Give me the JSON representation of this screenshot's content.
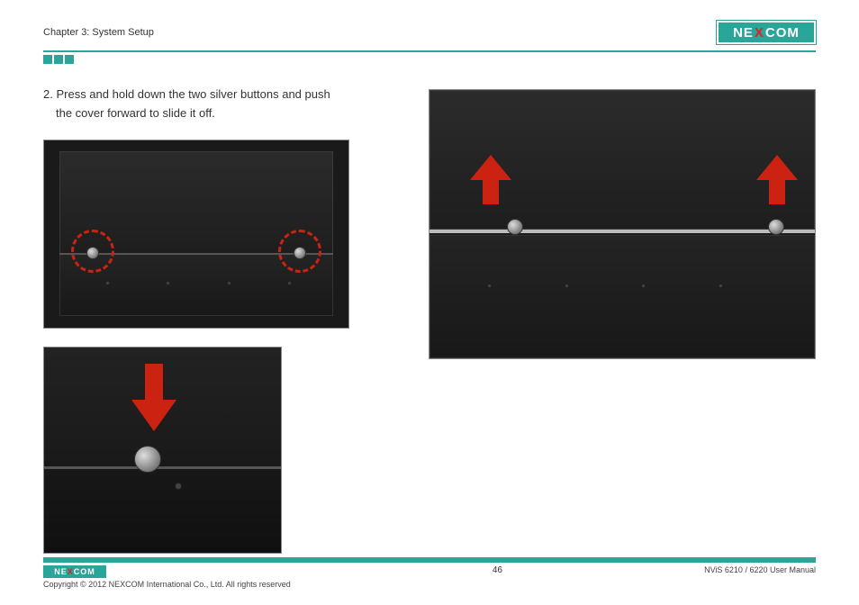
{
  "header": {
    "chapter": "Chapter 3: System Setup",
    "brand_left": "NE",
    "brand_x": "X",
    "brand_right": "COM"
  },
  "content": {
    "step_number": "2.",
    "step_line1": "Press and hold down the two silver buttons and push",
    "step_line2": "the cover forward to slide it off."
  },
  "footer": {
    "brand_left": "NE",
    "brand_x": "X",
    "brand_right": "COM",
    "copyright": "Copyright © 2012 NEXCOM International Co., Ltd. All rights reserved",
    "page_number": "46",
    "doc_title": "NViS 6210 / 6220 User Manual"
  }
}
